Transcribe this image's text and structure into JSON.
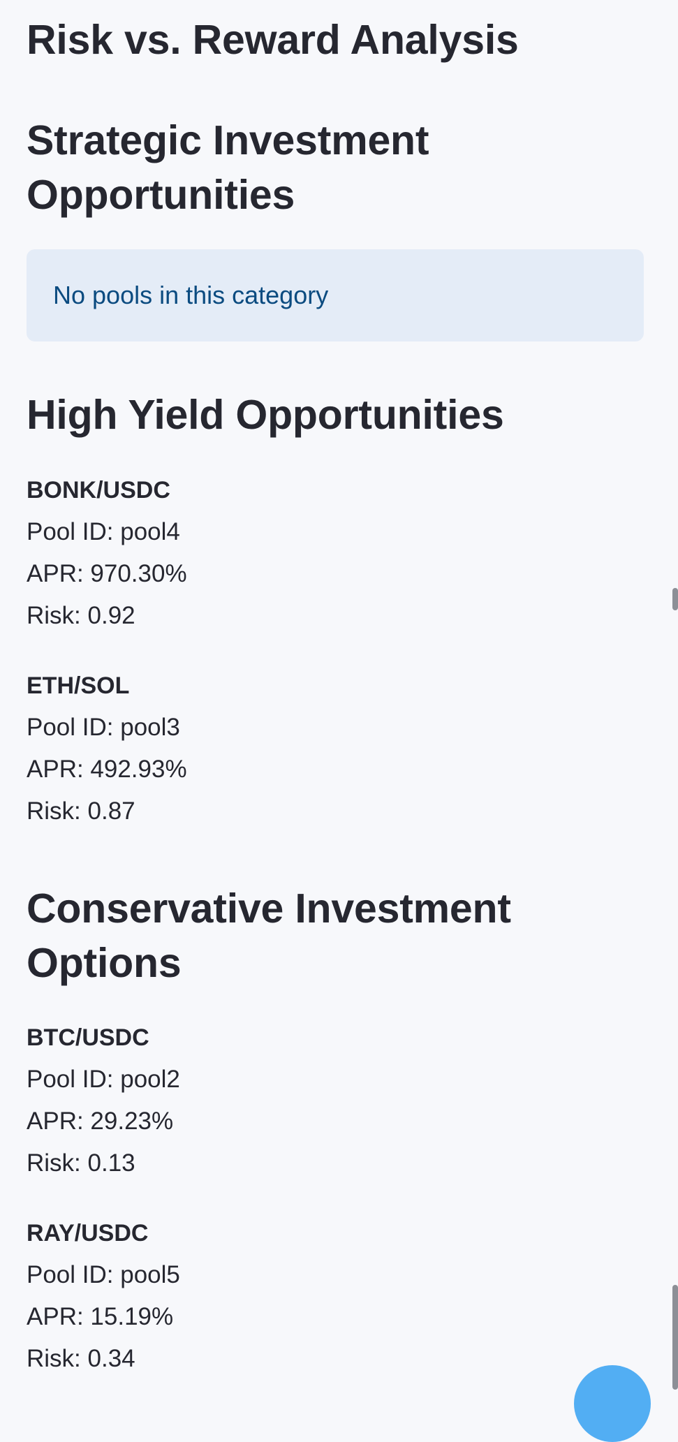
{
  "sections": {
    "risk_reward_title": "Risk vs. Reward Analysis",
    "strategic": {
      "title": "Strategic Investment Opportunities",
      "info": "No pools in this category"
    },
    "high_yield": {
      "title": "High Yield Opportunities",
      "pools": [
        {
          "name": "BONK/USDC",
          "pool_id": "Pool ID: pool4",
          "apr": "APR: 970.30%",
          "risk": "Risk: 0.92"
        },
        {
          "name": "ETH/SOL",
          "pool_id": "Pool ID: pool3",
          "apr": "APR: 492.93%",
          "risk": "Risk: 0.87"
        }
      ]
    },
    "conservative": {
      "title": "Conservative Investment Options",
      "pools": [
        {
          "name": "BTC/USDC",
          "pool_id": "Pool ID: pool2",
          "apr": "APR: 29.23%",
          "risk": "Risk: 0.13"
        },
        {
          "name": "RAY/USDC",
          "pool_id": "Pool ID: pool5",
          "apr": "APR: 15.19%",
          "risk": "Risk: 0.34"
        }
      ]
    }
  },
  "colors": {
    "background": "#f7f8fb",
    "text": "#262730",
    "info_bg": "#e4ecf7",
    "info_text": "#0b4b80",
    "fab": "#52aef3"
  }
}
